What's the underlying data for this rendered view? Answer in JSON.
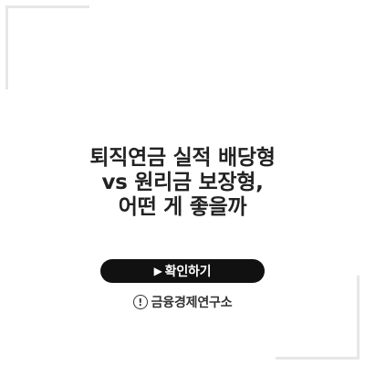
{
  "title": {
    "line1": "퇴직연금 실적 배당형",
    "line2": "vs 원리금 보장형,",
    "line3": "어떤 게 좋을까"
  },
  "button": {
    "icon": "play-triangle-icon",
    "label": "확인하기"
  },
  "brand": {
    "icon": "exclamation-circle-icon",
    "label": "금융경제연구소"
  },
  "colors": {
    "background": "#ffffff",
    "text": "#222222",
    "button_bg": "#111111",
    "button_text": "#ffffff",
    "corner_frame": "#e7e7e7"
  }
}
